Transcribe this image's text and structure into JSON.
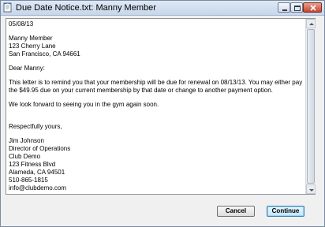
{
  "window": {
    "title": "Due Date Notice.txt: Manny Member"
  },
  "letter": {
    "date": "05/08/13",
    "recipient": {
      "name": "Manny Member",
      "street": "123 Cherry Lane",
      "city_state_zip": "San Francisco, CA  94661"
    },
    "greeting": "Dear Manny:",
    "body_paragraph_1": "This letter is to remind you that your membership will be due for renewal on 08/13/13.  You may either pay the $49.95 due on your current membership by that date or change to another payment option.",
    "body_paragraph_2": "We look forward to seeing you in the gym again soon.",
    "closing": "Respectfully yours,",
    "sender": {
      "name": "Jim Johnson",
      "title": "Director of Operations",
      "company": "Club Demo",
      "street": "123 Fitness Blvd",
      "city_state_zip": "Alameda, CA  94501",
      "phone": "510-865-1815",
      "email": "info@clubdemo.com"
    }
  },
  "buttons": {
    "cancel": "Cancel",
    "continue": "Continue"
  },
  "icons": {
    "app": "notepad-icon",
    "minimize": "minimize-icon",
    "maximize": "maximize-icon",
    "close": "close-icon",
    "scroll_up": "arrow-up-icon",
    "scroll_down": "arrow-down-icon"
  },
  "colors": {
    "titlebar": "#c6d6ea",
    "close_button": "#c8452d",
    "default_button_border": "#3c7fb1"
  }
}
